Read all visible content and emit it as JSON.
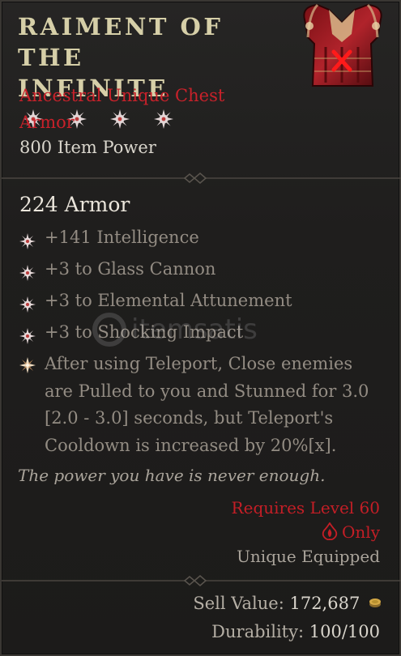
{
  "item": {
    "name_line1": "RAIMENT OF THE",
    "name_line2": "INFINITE",
    "rarity_type_line1": "Ancestral Unique Chest",
    "rarity_type_line2": "Armor",
    "item_power": "800 Item Power",
    "armor": "224 Armor",
    "image_icon": "chest-armor-icon"
  },
  "affixes": [
    {
      "text": "+141 Intelligence",
      "icon": "greater-affix-star-icon"
    },
    {
      "text": "+3 to Glass Cannon",
      "icon": "greater-affix-star-icon"
    },
    {
      "text": "+3 to Elemental Attunement",
      "icon": "greater-affix-star-icon"
    },
    {
      "text": "+3 to Shocking Impact",
      "icon": "greater-affix-star-icon"
    }
  ],
  "aspect": {
    "lines": [
      "After using Teleport, Close enemies",
      "are Pulled to you and Stunned for 3.0",
      "[2.0 - 3.0] seconds, but Teleport's",
      "Cooldown is increased by 20%[x]."
    ],
    "icon": "unique-aspect-star-icon"
  },
  "flavor": "The power you have is never enough.",
  "requirements": {
    "level": "Requires Level 60",
    "class": "Only",
    "class_icon": "sorcerer-class-icon",
    "unique": "Unique Equipped"
  },
  "footer": {
    "sell_label": "Sell Value:",
    "sell_value": "172,687",
    "durability_label": "Durability:",
    "durability_value": "100/100"
  },
  "watermark": "itemsatis",
  "colors": {
    "unique_red": "#c8212a",
    "title": "#d6cfa8",
    "affix_text": "#938c83",
    "background": "#1f1e1d"
  }
}
